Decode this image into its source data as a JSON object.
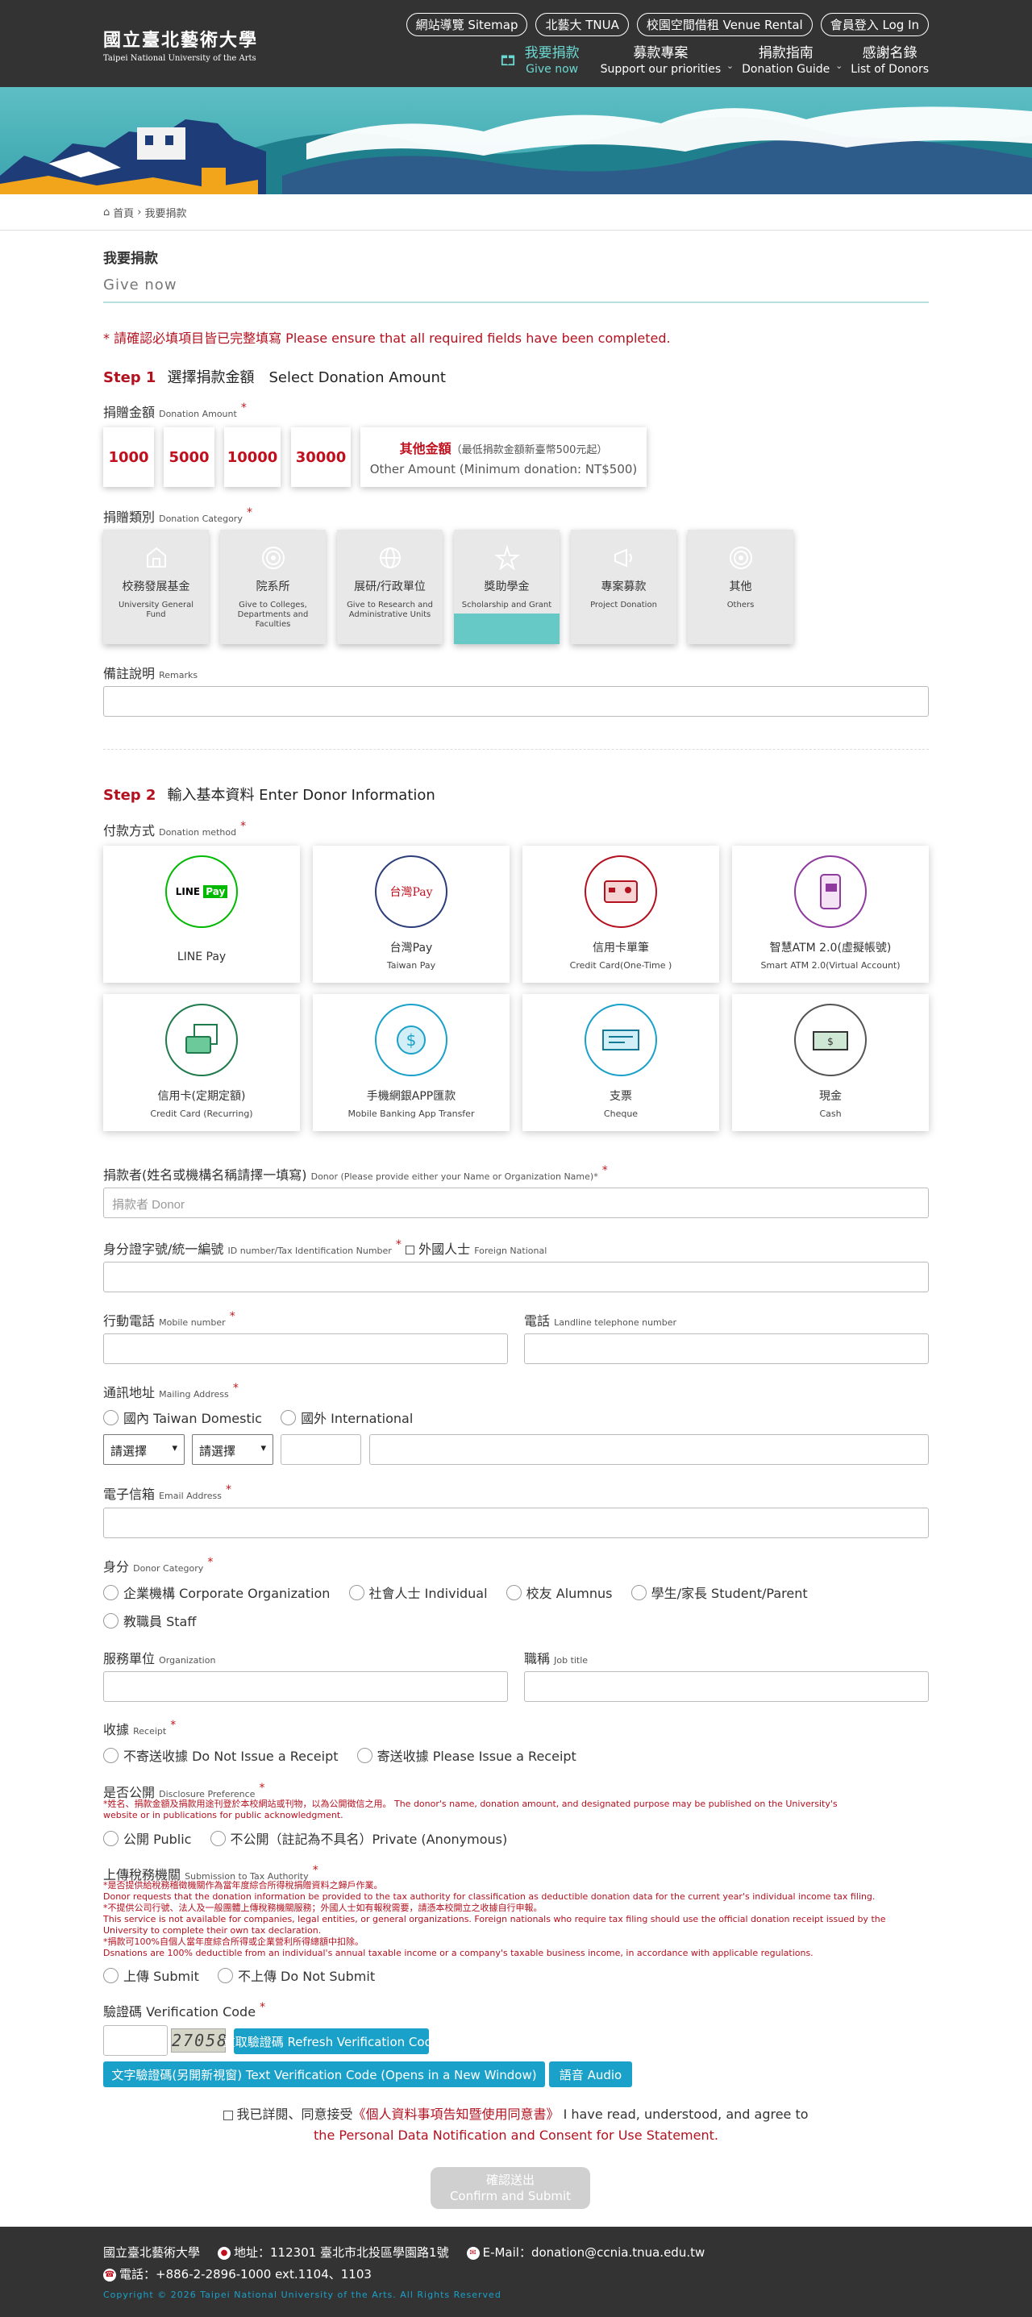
{
  "header": {
    "logo_zh": "國立臺北藝術大學",
    "logo_en": "Taipei National University of the Arts",
    "toplinks": [
      "網站導覽 Sitemap",
      "北藝大 TNUA",
      "校園空間借租 Venue Rental",
      "會員登入 Log In"
    ],
    "nav": [
      {
        "zh": "我要捐款",
        "en": "Give now"
      },
      {
        "zh": "募款專案",
        "en": "Support our priorities"
      },
      {
        "zh": "捐款指南",
        "en": "Donation Guide"
      },
      {
        "zh": "感謝名錄",
        "en": "List of Donors"
      }
    ]
  },
  "breadcrumb": {
    "home": "首頁",
    "sep": "›",
    "current": "我要捐款"
  },
  "page": {
    "title": "我要捐款",
    "subtitle": "Give now",
    "required_notice": "* 請確認必填項目皆已完整填寫 Please ensure that all required fields have been completed."
  },
  "step1": {
    "num": "Step 1",
    "title": "選擇捐款金額　Select Donation Amount",
    "amount_label": "捐贈金額",
    "amount_label_en": "Donation Amount",
    "amounts": [
      "1000",
      "5000",
      "10000",
      "30000"
    ],
    "other_zh": "其他金額",
    "other_min_zh": "（最低捐款金額新臺幣500元起）",
    "other_en": "Other Amount (Minimum donation: NT$500)",
    "category_label": "捐贈類別",
    "category_label_en": "Donation Category",
    "categories": [
      {
        "zh": "校務發展基金",
        "en": "University General Fund",
        "icon": "building-icon"
      },
      {
        "zh": "院系所",
        "en": "Give to Colleges, Departments and Faculties",
        "icon": "target-icon"
      },
      {
        "zh": "展研/行政單位",
        "en": "Give to Research and Administrative Units",
        "icon": "globe-icon"
      },
      {
        "zh": "獎助學金",
        "en": "Scholarship and Grant",
        "icon": "star-icon"
      },
      {
        "zh": "專案募款",
        "en": "Project Donation",
        "icon": "megaphone-icon"
      },
      {
        "zh": "其他",
        "en": "Others",
        "icon": "target-icon"
      }
    ],
    "remarks_label": "備註說明",
    "remarks_label_en": "Remarks"
  },
  "step2": {
    "num": "Step 2",
    "title": "輸入基本資料 Enter Donor Information",
    "method_label": "付款方式",
    "method_label_en": "Donation method",
    "methods": [
      {
        "zh": "LINE Pay",
        "en": ""
      },
      {
        "zh": "台灣Pay",
        "en": "Taiwan Pay"
      },
      {
        "zh": "信用卡單筆",
        "en": "Credit Card(One-Time )"
      },
      {
        "zh": "智慧ATM 2.0(虛擬帳號)",
        "en": "Smart ATM 2.0(Virtual Account)"
      },
      {
        "zh": "信用卡(定期定額)",
        "en": "Credit Card (Recurring)"
      },
      {
        "zh": "手機網銀APP匯款",
        "en": "Mobile Banking App Transfer"
      },
      {
        "zh": "支票",
        "en": "Cheque"
      },
      {
        "zh": "現金",
        "en": "Cash"
      }
    ],
    "donor_label": "捐款者(姓名或機構名稱請擇一填寫)",
    "donor_label_en": "Donor (Please provide either your Name or Organization Name)*",
    "donor_placeholder": "捐款者 Donor",
    "id_label": "身分證字號/統一編號",
    "id_label_en": "ID number/Tax Identification Number",
    "foreign_label": "外國人士",
    "foreign_label_en": "Foreign National",
    "mobile_label": "行動電話",
    "mobile_label_en": "Mobile number",
    "phone_label": "電話",
    "phone_label_en": "Landline telephone number",
    "address_label": "通訊地址",
    "address_label_en": "Mailing Address",
    "address_options": [
      "國內 Taiwan Domestic",
      "國外 International"
    ],
    "select_placeholder": "請選擇",
    "email_label": "電子信箱",
    "email_label_en": "Email Address",
    "identity_label": "身分",
    "identity_label_en": "Donor Category",
    "identity_options": [
      "企業機構 Corporate Organization",
      "社會人士 Individual",
      "校友 Alumnus",
      "學生/家長 Student/Parent",
      "教職員 Staff"
    ],
    "org_label": "服務單位",
    "org_label_en": "Organization",
    "job_label": "職稱",
    "job_label_en": "Job title",
    "receipt_label": "收據",
    "receipt_label_en": "Receipt",
    "receipt_options": [
      "不寄送收據 Do Not Issue a Receipt",
      "寄送收據 Please Issue a Receipt"
    ],
    "disclosure_label": "是否公開",
    "disclosure_label_en": "Disclosure Preference",
    "disclosure_note_1": "*姓名、捐款金額及捐款用途刊登於本校網站或刊物，以為公開徵信之用。 The donor's name, donation amount, and designated purpose may be published on the University's",
    "disclosure_note_2": "website or in publications for public acknowledgment.",
    "disclosure_options": [
      "公開 Public",
      "不公開（註記為不具名）Private (Anonymous)"
    ],
    "tax_label": "上傳稅務機關",
    "tax_label_en": "Submission to Tax Authority",
    "tax_notes": [
      "*是否提供給稅務稽徵機關作為當年度綜合所得稅捐贈資料之歸戶作業。",
      "Donor requests that the donation information be provided to the tax authority for classification as deductible donation data for the current year's individual income tax filing.",
      "*不提供公司行號、法人及一般團體上傳稅務機關服務；外國人士如有報稅需要，請憑本校開立之收據自行申報。",
      "This service is not available for companies, legal entities, or general organizations. Foreign nationals who require tax filing should use the official donation receipt issued by the",
      "University to complete their own tax declaration.",
      "*捐款可100%自個人當年度綜合所得或企業營利所得總額中扣除。",
      "Dsnations are 100% deductible from an individual's annual taxable income or a company's taxable business income, in accordance with applicable regulations."
    ],
    "tax_options": [
      "上傳 Submit",
      "不上傳 Do Not Submit"
    ],
    "captcha_label": "驗證碼 Verification Code",
    "captcha_code": "27058",
    "btn_refresh": "重取驗證碼 Refresh Verification Code",
    "btn_text_code": "文字驗證碼(另開新視窗) Text Verification Code (Opens in a New Window)",
    "btn_audio": "語音 Audio",
    "consent_pre": "我已詳閱、同意接受",
    "consent_link": "《個人資料事項告知暨使用同意書》",
    "consent_en": "I have read, understood, and agree to",
    "consent_en_link": "the Personal Data Notification and Consent for Use Statement.",
    "submit_zh": "確認送出",
    "submit_en": "Confirm and Submit"
  },
  "footer": {
    "name": "國立臺北藝術大學",
    "address": "地址：112301 臺北市北投區學園路1號",
    "email": "E-Mail：donation@ccnia.tnua.edu.tw",
    "phone": "電話：+886-2-2896-1000 ext.1104、1103",
    "copyright": "Copyright © 2026 Taipei National University of the Arts. All Rights Reserved"
  },
  "colors": {
    "accent": "#b3111f",
    "teal": "#66c9c6",
    "button": "#1aa1c9",
    "header": "#333333"
  }
}
